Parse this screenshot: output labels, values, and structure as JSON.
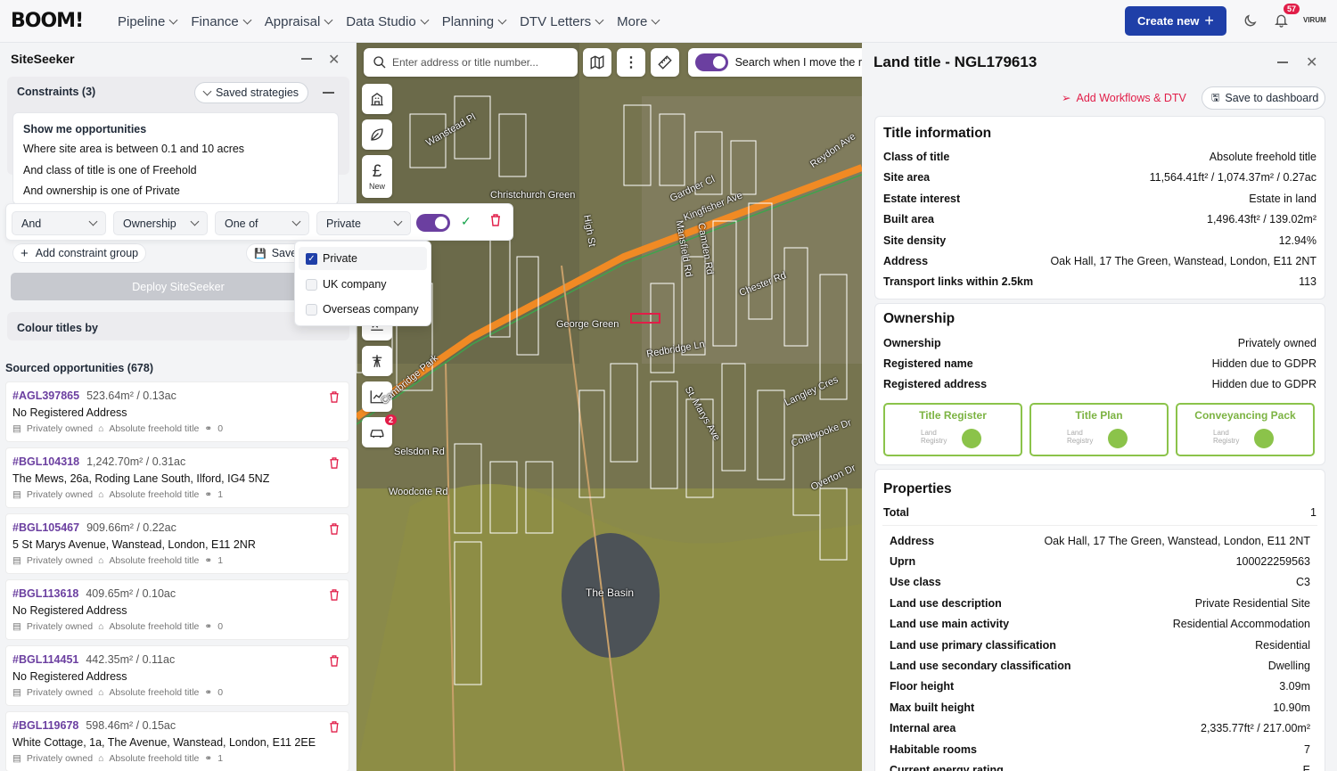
{
  "brand": {
    "logo": "BOOM!"
  },
  "nav": {
    "items": [
      "Pipeline",
      "Finance",
      "Appraisal",
      "Data Studio",
      "Planning",
      "DTV Letters",
      "More"
    ],
    "create_label": "Create new",
    "notif_count": "57",
    "user_label": "VIRUM"
  },
  "siteseeker": {
    "title": "SiteSeeker",
    "constraints_label": "Constraints (3)",
    "saved_label": "Saved strategies",
    "show_label": "Show me opportunities",
    "conditions": [
      "Where site area is between 0.1 and 10 acres",
      "And class of title is one of Freehold",
      "And ownership is one of Private"
    ],
    "builder": {
      "conj": "And",
      "field": "Ownership",
      "op": "One of",
      "value": "Private"
    },
    "dropdown_options": [
      {
        "label": "Private",
        "checked": true
      },
      {
        "label": "UK company",
        "checked": false
      },
      {
        "label": "Overseas company",
        "checked": false
      }
    ],
    "add_group_label": "Add constraint group",
    "save_label": "Save",
    "deploy_label": "Deploy SiteSeeker",
    "colour_label": "Colour titles by",
    "sourced_label": "Sourced opportunities (678)",
    "items": [
      {
        "id": "#AGL397865",
        "area": "523.64m² / 0.13ac",
        "address": "No Registered Address",
        "owner": "Privately owned",
        "title": "Absolute freehold title",
        "count": "0"
      },
      {
        "id": "#BGL104318",
        "area": "1,242.70m² / 0.31ac",
        "address": "The Mews, 26a, Roding Lane South, Ilford, IG4 5NZ",
        "owner": "Privately owned",
        "title": "Absolute freehold title",
        "count": "1"
      },
      {
        "id": "#BGL105467",
        "area": "909.66m² / 0.22ac",
        "address": "5 St Marys Avenue, Wanstead, London, E11 2NR",
        "owner": "Privately owned",
        "title": "Absolute freehold title",
        "count": "1"
      },
      {
        "id": "#BGL113618",
        "area": "409.65m² / 0.10ac",
        "address": "No Registered Address",
        "owner": "Privately owned",
        "title": "Absolute freehold title",
        "count": "0"
      },
      {
        "id": "#BGL114451",
        "area": "442.35m² / 0.11ac",
        "address": "No Registered Address",
        "owner": "Privately owned",
        "title": "Absolute freehold title",
        "count": "0"
      },
      {
        "id": "#BGL119678",
        "area": "598.46m² / 0.15ac",
        "address": "White Cottage, 1a, The Avenue, Wanstead, London, E11 2EE",
        "owner": "Privately owned",
        "title": "Absolute freehold title",
        "count": "1"
      }
    ]
  },
  "map": {
    "search_placeholder": "Enter address or title number...",
    "search_move_label": "Search when I move the r",
    "new_label": "New",
    "car_badge": "2",
    "labels": [
      "Wanstead Pl",
      "Christchurch Green",
      "George Green",
      "Gardner Cl",
      "Kingfisher Ave",
      "Reydon Ave",
      "High St",
      "Chester Rd",
      "Redbridge Ln",
      "Cambridge Park",
      "Langley Cres",
      "Colebrooke Dr",
      "Overton Dr",
      "Selsdon Rd",
      "Woodcote Rd",
      "The Basin",
      "Mansfield Rd",
      "Camden Rd",
      "St. Marys Ave"
    ]
  },
  "title_panel": {
    "title": "Land title - NGL179613",
    "workflows_label": "Add Workflows & DTV",
    "dashboard_label": "Save to dashboard",
    "title_info": {
      "heading": "Title information",
      "rows": [
        {
          "k": "Class of title",
          "v": "Absolute freehold title"
        },
        {
          "k": "Site area",
          "v": "11,564.41ft² / 1,074.37m² / 0.27ac"
        },
        {
          "k": "Estate interest",
          "v": "Estate in land"
        },
        {
          "k": "Built area",
          "v": "1,496.43ft² / 139.02m²"
        },
        {
          "k": "Site density",
          "v": "12.94%"
        },
        {
          "k": "Address",
          "v": "Oak Hall, 17 The Green, Wanstead, London, E11 2NT"
        },
        {
          "k": "Transport links within 2.5km",
          "v": "113"
        }
      ]
    },
    "ownership": {
      "heading": "Ownership",
      "rows": [
        {
          "k": "Ownership",
          "v": "Privately owned"
        },
        {
          "k": "Registered name",
          "v": "Hidden due to GDPR"
        },
        {
          "k": "Registered address",
          "v": "Hidden due to GDPR"
        }
      ]
    },
    "docs": [
      {
        "label": "Title Register",
        "sub1": "Land",
        "sub2": "Registry"
      },
      {
        "label": "Title Plan",
        "sub1": "Land",
        "sub2": "Registry"
      },
      {
        "label": "Conveyancing Pack",
        "sub1": "Land",
        "sub2": "Registry"
      }
    ],
    "properties": {
      "heading": "Properties",
      "total_k": "Total",
      "total_v": "1",
      "rows": [
        {
          "k": "Address",
          "v": "Oak Hall, 17 The Green, Wanstead, London, E11 2NT"
        },
        {
          "k": "Uprn",
          "v": "100022259563"
        },
        {
          "k": "Use class",
          "v": "C3"
        },
        {
          "k": "Land use description",
          "v": "Private Residential Site"
        },
        {
          "k": "Land use main activity",
          "v": "Residential Accommodation"
        },
        {
          "k": "Land use primary classification",
          "v": "Residential"
        },
        {
          "k": "Land use secondary classification",
          "v": "Dwelling"
        },
        {
          "k": "Floor height",
          "v": "3.09m"
        },
        {
          "k": "Max built height",
          "v": "10.90m"
        },
        {
          "k": "Internal area",
          "v": "2,335.77ft² / 217.00m²"
        },
        {
          "k": "Habitable rooms",
          "v": "7"
        },
        {
          "k": "Current energy rating",
          "v": "E"
        }
      ]
    }
  }
}
